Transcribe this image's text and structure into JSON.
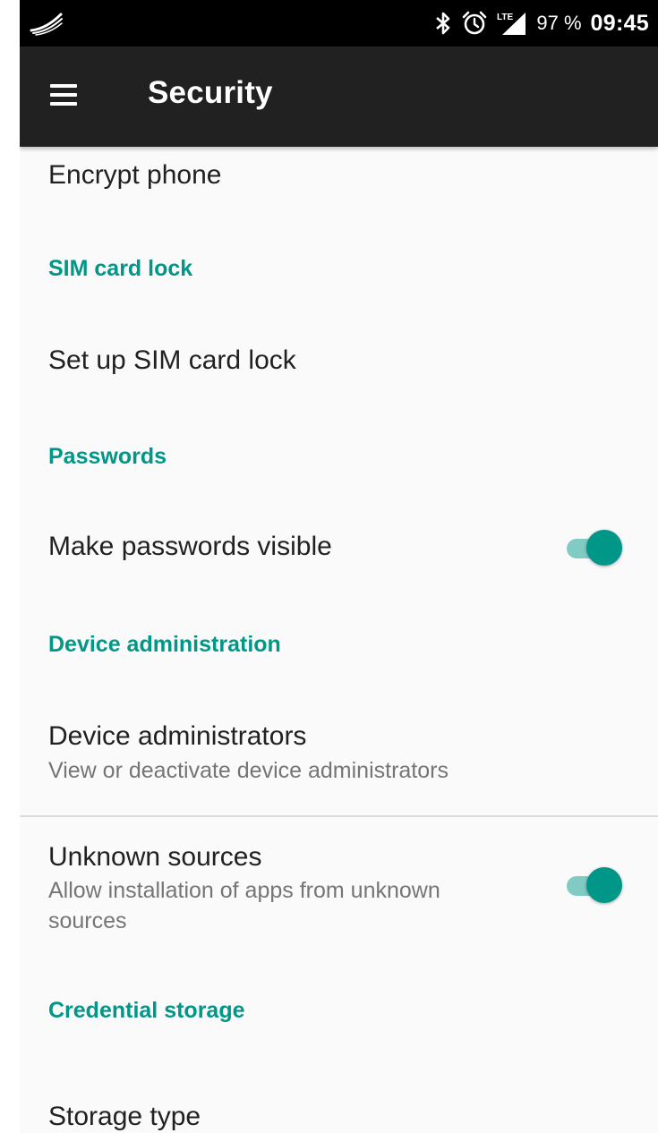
{
  "status_bar": {
    "battery": "97 %",
    "time": "09:45",
    "icons": [
      "swype-icon",
      "bluetooth-icon",
      "alarm-icon",
      "lte-signal-icon"
    ]
  },
  "app_bar": {
    "title": "Security",
    "menu_icon": "hamburger-menu-icon"
  },
  "settings": {
    "encrypt": {
      "title": "Encrypt phone"
    },
    "sim_category": {
      "title": "SIM card lock"
    },
    "sim_setup": {
      "title": "Set up SIM card lock"
    },
    "passwords_category": {
      "title": "Passwords"
    },
    "make_passwords_visible": {
      "title": "Make passwords visible",
      "enabled": true
    },
    "device_admin_category": {
      "title": "Device administration"
    },
    "device_admins": {
      "title": "Device administrators",
      "summary": "View or deactivate device administrators"
    },
    "unknown_sources": {
      "title": "Unknown sources",
      "summary": "Allow installation of apps from unknown sources",
      "enabled": true
    },
    "credential_category": {
      "title": "Credential storage"
    },
    "storage_type": {
      "title": "Storage type"
    }
  },
  "colors": {
    "accent": "#009688",
    "accent_light": "#80cbc4",
    "toolbar": "#212121",
    "background": "#fafafa"
  }
}
